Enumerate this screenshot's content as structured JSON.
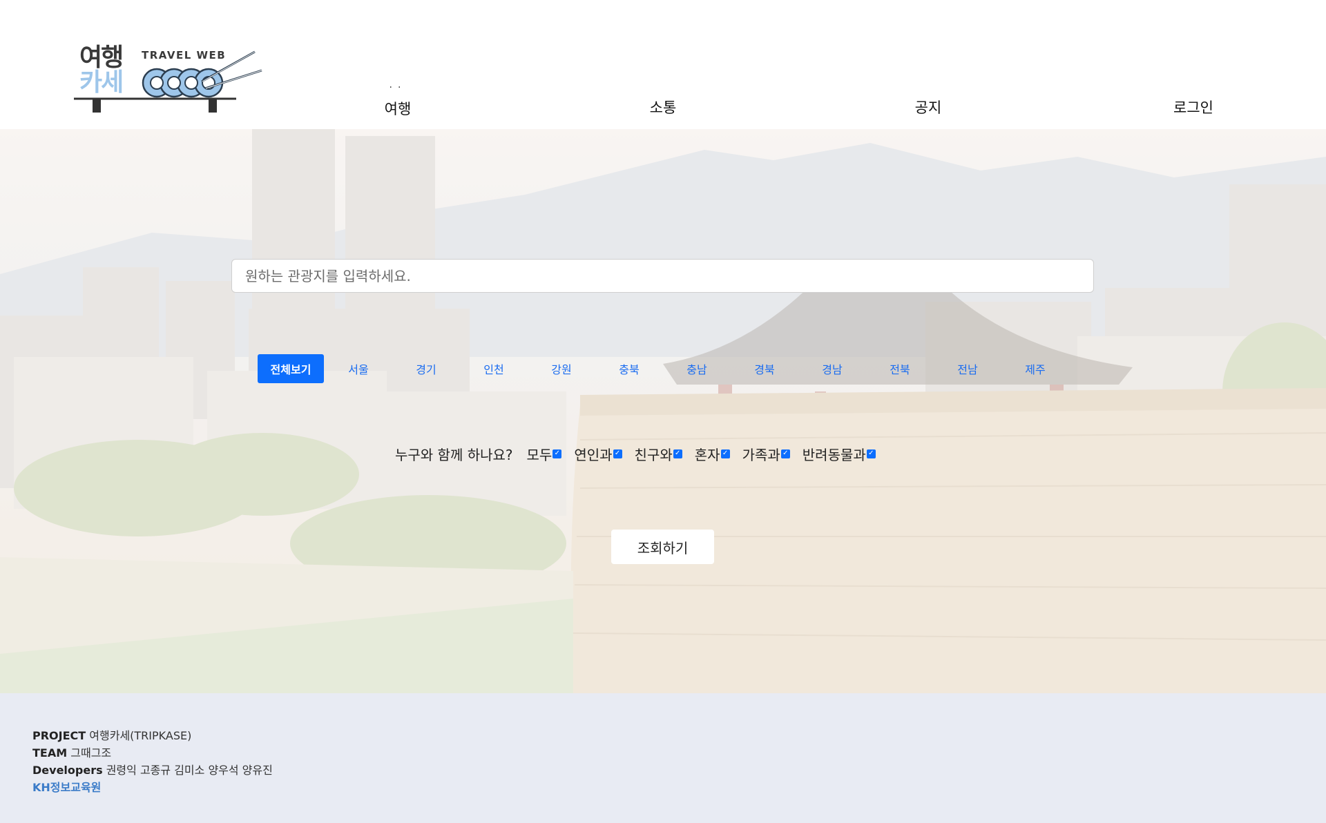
{
  "logo": {
    "line1": "여행",
    "line2": "카세",
    "tagline": "TRAVEL WEB"
  },
  "nav": {
    "items": [
      {
        "label": "여행"
      },
      {
        "label": "소통"
      },
      {
        "label": "공지"
      },
      {
        "label": "로그인"
      }
    ]
  },
  "search": {
    "placeholder": "원하는 관광지를 입력하세요."
  },
  "regions": {
    "items": [
      "전체보기",
      "서울",
      "경기",
      "인천",
      "강원",
      "충북",
      "충남",
      "경북",
      "경남",
      "전북",
      "전남",
      "제주"
    ],
    "active": "전체보기"
  },
  "companion": {
    "question": "누구와 함께 하나요?",
    "options": [
      {
        "label": "모두",
        "checked": true
      },
      {
        "label": "연인과",
        "checked": true
      },
      {
        "label": "친구와",
        "checked": true
      },
      {
        "label": "혼자",
        "checked": true
      },
      {
        "label": "가족과",
        "checked": true
      },
      {
        "label": "반려동물과",
        "checked": true
      }
    ]
  },
  "submit_label": "조회하기",
  "footer": {
    "project_key": "PROJECT",
    "project_val": "여행카세(TRIPKASE)",
    "team_key": "TEAM",
    "team_val": "그때그조",
    "dev_key": "Developers",
    "dev_val": "권령익 고종규 김미소 양우석 양유진",
    "org": "KH정보교육원"
  },
  "colors": {
    "accent": "#0d6efd",
    "footer_bg": "#e8ebf3",
    "logo_blue": "#9ec6ea"
  }
}
